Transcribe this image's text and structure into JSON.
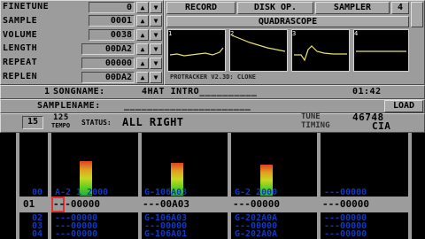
{
  "sample": {
    "finetune_label": "FINETUNE",
    "finetune_value": "0",
    "sample_label": "SAMPLE",
    "sample_value": "0001",
    "volume_label": "VOLUME",
    "volume_value": "0038",
    "length_label": "LENGTH",
    "length_value": "00DA2",
    "repeat_label": "REPEAT",
    "repeat_value": "00000",
    "replen_label": "REPLEN",
    "replen_value": "00DA2"
  },
  "menu": {
    "record": "RECORD",
    "disk_op": "DISK OP.",
    "sampler": "SAMPLER",
    "channels": "4",
    "quadrascope": "QUADRASCOPE",
    "scope_labels": [
      "1",
      "2",
      "3",
      "4"
    ]
  },
  "version_text": "PROTRACKER V2.3D: CLONE",
  "song": {
    "number": "1",
    "label": "SONGNAME:",
    "name": "4HAT INTRO__________",
    "time": "01:42"
  },
  "samplename": {
    "label": "SAMPLENAME:",
    "value": "______________________",
    "load": "LOAD"
  },
  "status": {
    "octave": "15",
    "tempo_value": "125",
    "tempo_label": "TEMPO",
    "status_label": "STATUS:",
    "status_text": "ALL RIGHT",
    "tune_label": "TUNE",
    "tune_value": "46748",
    "timing_label": "TIMING",
    "timing_value": "CIA"
  },
  "meters": [
    0.65,
    0.62,
    0.58,
    0.0
  ],
  "pattern": {
    "row_above": "00",
    "cur_row": "01",
    "rows_below": [
      "02",
      "03",
      "04"
    ],
    "channels": [
      {
        "above": "A-2 1 2000",
        "current": "---00000",
        "below": [
          "---00000",
          "---00000",
          "---00000"
        ]
      },
      {
        "above": "G-106A03",
        "current": "---00A03",
        "below": [
          "G-106A03",
          "---00000",
          "G-106A01"
        ]
      },
      {
        "above": "G-2 2000",
        "current": "---00000",
        "below": [
          "G-202A0A",
          "---00000",
          "G-202A0A"
        ]
      },
      {
        "above": "---00000",
        "current": "---00000",
        "below": [
          "---00000",
          "---00000",
          "---00000"
        ]
      }
    ]
  }
}
